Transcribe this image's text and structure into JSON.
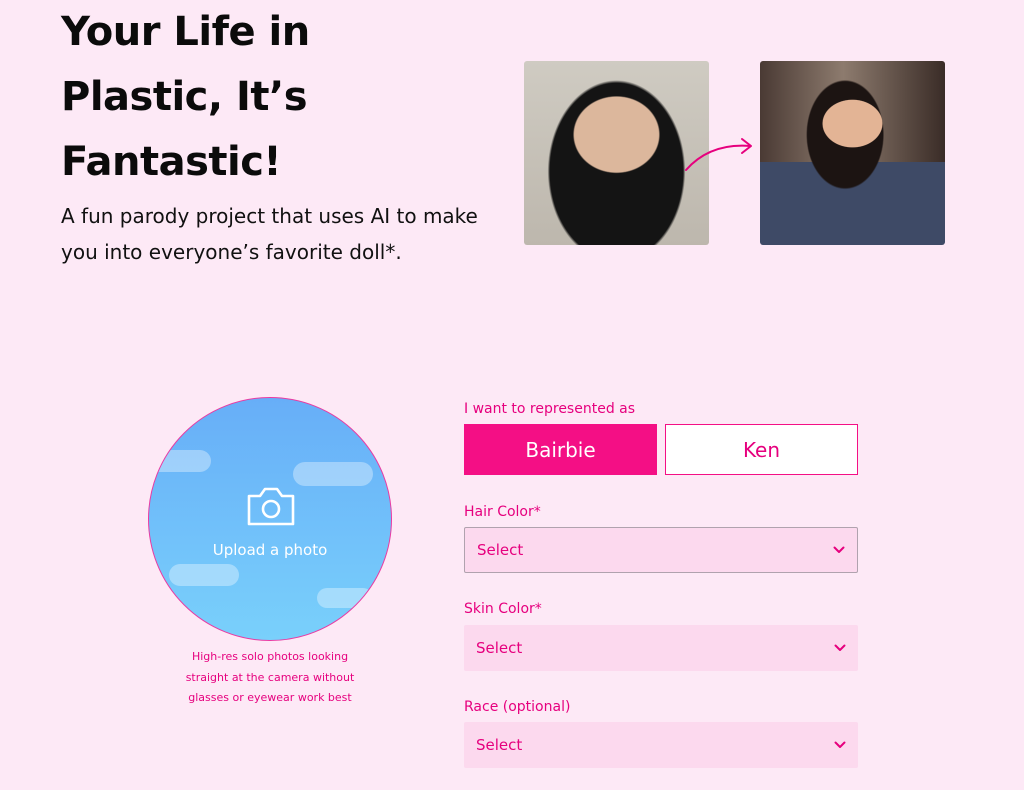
{
  "hero": {
    "title": "Your Life in Plastic, It’s Fantastic!",
    "subtitle": "A fun parody project that uses AI to make you into everyone’s favorite doll*."
  },
  "upload": {
    "label": "Upload a photo",
    "hint": "High-res solo photos looking straight at the camera without glasses or eyewear work best"
  },
  "form": {
    "represent_label": "I want to represented as",
    "options": [
      "Bairbie",
      "Ken"
    ],
    "selected_option": "Bairbie",
    "hair_label": "Hair Color*",
    "hair_value": "Select",
    "skin_label": "Skin Color*",
    "skin_value": "Select",
    "race_label": "Race (optional)",
    "race_value": "Select"
  },
  "colors": {
    "background": "#fde9f6",
    "accent": "#f40f85",
    "accent_text": "#e6007e",
    "select_bg": "#fcd9ee"
  }
}
